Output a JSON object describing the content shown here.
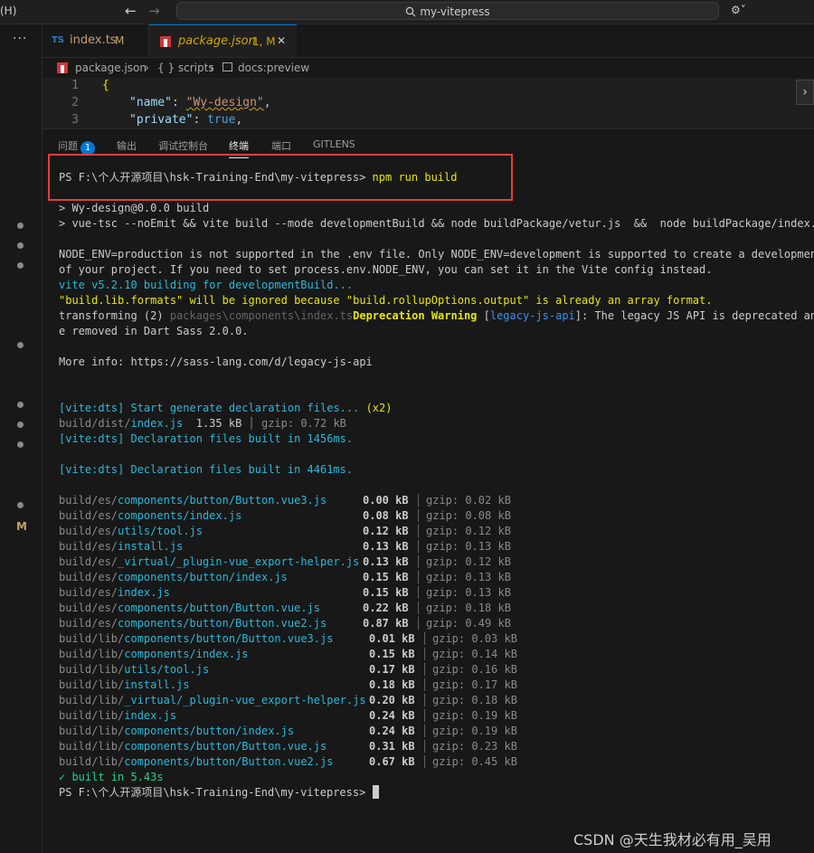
{
  "titlebar": {
    "menu_fragment": "(H)",
    "back_glyph": "←",
    "forward_glyph": "→",
    "search_text": "my-vitepress",
    "copilot_glyph": "⚙︎˅"
  },
  "activity": {
    "more_glyph": "···",
    "scm_marker": "M"
  },
  "tabs": [
    {
      "icon": "TS",
      "label": "index.ts",
      "status": "M"
    },
    {
      "label": "package.json",
      "status": "1, M",
      "close": "✕"
    }
  ],
  "breadcrumb": {
    "file": "package.json",
    "sep1": "›",
    "scripts": "{ } scripts",
    "sep2": "›",
    "item": "docs:preview"
  },
  "editor": {
    "lines": [
      {
        "num": "1",
        "brace": "{"
      },
      {
        "num": "2",
        "key": "\"name\"",
        "colon": ": ",
        "value": "\"Wy-design\"",
        "comma": ","
      },
      {
        "num": "3",
        "key": "\"private\"",
        "colon": ": ",
        "value": "true",
        "comma": ","
      }
    ]
  },
  "panel_tabs": [
    {
      "label": "问题",
      "badge": "1"
    },
    {
      "label": "输出"
    },
    {
      "label": "调试控制台"
    },
    {
      "label": "终端"
    },
    {
      "label": "端口"
    },
    {
      "label": "GITLENS"
    }
  ],
  "terminal": {
    "prompt": "PS F:\\个人开源项目\\hsk-Training-End\\my-vitepress> ",
    "command": "npm run build",
    "lines": [
      "> Wy-design@0.0.0 build",
      "> vue-tsc --noEmit && vite build --mode developmentBuild && node buildPackage/vetur.js  &&  node buildPackage/index.js",
      "NODE_ENV=production is not supported in the .env file. Only NODE_ENV=development is supported to create a development bu",
      "of your project. If you need to set process.env.NODE_ENV, you can set it in the Vite config instead.",
      "vite v5.2.10 building for developmentBuild...",
      "\"build.lib.formats\" will be ignored because \"build.rollupOptions.output\" is already an array format.",
      "transforming (2) ",
      "packages\\components\\index.ts",
      "Deprecation Warning",
      " [",
      "legacy-js-api",
      "]: The legacy JS API is deprecated and wi",
      "e removed in Dart Sass 2.0.0.",
      "More info: https://sass-lang.com/d/legacy-js-api",
      "[vite:dts] Start generate declaration files... ",
      "(x2)",
      "build/dist/",
      "index.js",
      "  1.35 kB",
      " │ gzip: 0.72 kB",
      "[vite:dts] Declaration files built in 1456ms.",
      "[vite:dts] Declaration files built in 4461ms.",
      "✓ built in 5.43s"
    ],
    "build_files": [
      {
        "dir": "build/es/",
        "file": "components/button/Button.vue3.js",
        "size": "0.00 kB",
        "gzip": "gzip: 0.02 kB"
      },
      {
        "dir": "build/es/",
        "file": "components/index.js",
        "size": "0.08 kB",
        "gzip": "gzip: 0.08 kB"
      },
      {
        "dir": "build/es/",
        "file": "utils/tool.js",
        "size": "0.12 kB",
        "gzip": "gzip: 0.12 kB"
      },
      {
        "dir": "build/es/",
        "file": "install.js",
        "size": "0.13 kB",
        "gzip": "gzip: 0.13 kB"
      },
      {
        "dir": "build/es/",
        "file": "_virtual/_plugin-vue_export-helper.js",
        "size": "0.13 kB",
        "gzip": "gzip: 0.12 kB"
      },
      {
        "dir": "build/es/",
        "file": "components/button/index.js",
        "size": "0.15 kB",
        "gzip": "gzip: 0.13 kB"
      },
      {
        "dir": "build/es/",
        "file": "index.js",
        "size": "0.15 kB",
        "gzip": "gzip: 0.13 kB"
      },
      {
        "dir": "build/es/",
        "file": "components/button/Button.vue.js",
        "size": "0.22 kB",
        "gzip": "gzip: 0.18 kB"
      },
      {
        "dir": "build/es/",
        "file": "components/button/Button.vue2.js",
        "size": "0.87 kB",
        "gzip": "gzip: 0.49 kB"
      },
      {
        "dir": "build/lib/",
        "file": "components/button/Button.vue3.js",
        "size": "0.01 kB",
        "gzip": "gzip: 0.03 kB"
      },
      {
        "dir": "build/lib/",
        "file": "components/index.js",
        "size": "0.15 kB",
        "gzip": "gzip: 0.14 kB"
      },
      {
        "dir": "build/lib/",
        "file": "utils/tool.js",
        "size": "0.17 kB",
        "gzip": "gzip: 0.16 kB"
      },
      {
        "dir": "build/lib/",
        "file": "install.js",
        "size": "0.18 kB",
        "gzip": "gzip: 0.17 kB"
      },
      {
        "dir": "build/lib/",
        "file": "_virtual/_plugin-vue_export-helper.js",
        "size": "0.20 kB",
        "gzip": "gzip: 0.18 kB"
      },
      {
        "dir": "build/lib/",
        "file": "index.js",
        "size": "0.24 kB",
        "gzip": "gzip: 0.19 kB"
      },
      {
        "dir": "build/lib/",
        "file": "components/button/index.js",
        "size": "0.24 kB",
        "gzip": "gzip: 0.19 kB"
      },
      {
        "dir": "build/lib/",
        "file": "components/button/Button.vue.js",
        "size": "0.31 kB",
        "gzip": "gzip: 0.23 kB"
      },
      {
        "dir": "build/lib/",
        "file": "components/button/Button.vue2.js",
        "size": "0.67 kB",
        "gzip": "gzip: 0.45 kB"
      }
    ],
    "final_prompt": "PS F:\\个人开源项目\\hsk-Training-End\\my-vitepress> "
  },
  "watermark": "CSDN @天生我材必有用_吴用",
  "colors": {
    "background": "#181818",
    "accent": "#0078d4",
    "highlight_box": "#e0403a",
    "terminal_green": "#23d18b",
    "terminal_blue": "#3b8eea",
    "terminal_yellow": "#e5e510"
  }
}
